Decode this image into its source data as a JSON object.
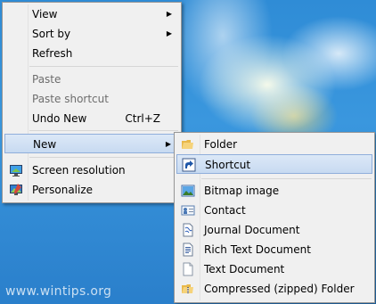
{
  "main_menu": {
    "items": [
      {
        "label": "View",
        "has_submenu": true
      },
      {
        "label": "Sort by",
        "has_submenu": true
      },
      {
        "label": "Refresh"
      },
      {
        "label": "Paste",
        "disabled": true
      },
      {
        "label": "Paste shortcut",
        "disabled": true
      },
      {
        "label": "Undo New",
        "accelerator": "Ctrl+Z"
      },
      {
        "label": "New",
        "has_submenu": true,
        "highlighted": true
      },
      {
        "label": "Screen resolution",
        "icon": "screen-resolution-icon"
      },
      {
        "label": "Personalize",
        "icon": "personalize-icon"
      }
    ],
    "arrow_glyph": "▶"
  },
  "new_submenu": {
    "items": [
      {
        "label": "Folder",
        "icon": "folder-icon"
      },
      {
        "label": "Shortcut",
        "icon": "shortcut-icon",
        "highlighted": true
      },
      {
        "label": "Bitmap image",
        "icon": "bitmap-image-icon"
      },
      {
        "label": "Contact",
        "icon": "contact-icon"
      },
      {
        "label": "Journal Document",
        "icon": "journal-document-icon"
      },
      {
        "label": "Rich Text Document",
        "icon": "rich-text-document-icon"
      },
      {
        "label": "Text Document",
        "icon": "text-document-icon"
      },
      {
        "label": "Compressed (zipped) Folder",
        "icon": "zipped-folder-icon"
      }
    ]
  },
  "watermark": "www.wintips.org",
  "colors": {
    "menu_background": "#f0f0f0",
    "highlight": "#c7daf1",
    "highlight_border": "#8faedb",
    "desktop": "#2f8cd6"
  }
}
